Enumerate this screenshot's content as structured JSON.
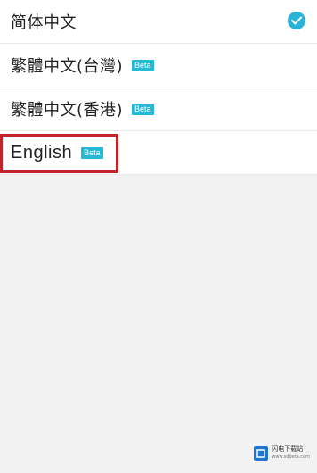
{
  "languages": [
    {
      "label": "简体中文",
      "badge": "",
      "selected": true
    },
    {
      "label": "繁體中文(台灣)",
      "badge": "Beta",
      "selected": false
    },
    {
      "label": "繁體中文(香港)",
      "badge": "Beta",
      "selected": false
    },
    {
      "label": "English",
      "badge": "Beta",
      "selected": false
    }
  ],
  "accent_color": "#2ab3d8",
  "highlight_color": "#c0272d",
  "watermark": {
    "title": "闪电下载站",
    "url": "www.sdbeta.com"
  }
}
